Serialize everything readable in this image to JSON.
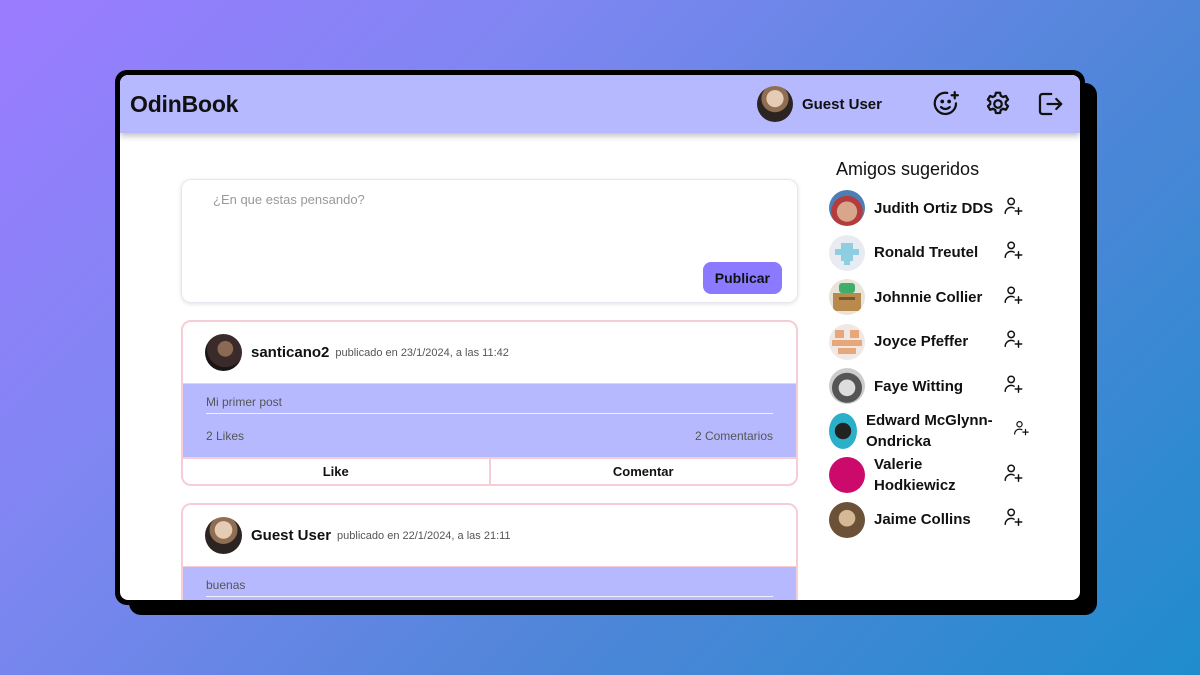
{
  "app": {
    "brand": "OdinBook"
  },
  "header": {
    "user_name": "Guest User",
    "icons": [
      "add-emoji-icon",
      "settings-gear-icon",
      "logout-icon"
    ]
  },
  "composer": {
    "placeholder": "¿En que estas pensando?",
    "publish_label": "Publicar"
  },
  "posts": [
    {
      "author": "santicano2",
      "date": "publicado en 23/1/2024, a las 11:42",
      "text": "Mi primer post",
      "likes": "2 Likes",
      "comments": "2 Comentarios",
      "like_label": "Like",
      "comment_label": "Comentar"
    },
    {
      "author": "Guest User",
      "date": "publicado en 22/1/2024, a las 21:11",
      "text": "buenas"
    }
  ],
  "sidebar": {
    "title": "Amigos sugeridos",
    "friends": [
      {
        "name": "Judith Ortiz DDS"
      },
      {
        "name": "Ronald Treutel"
      },
      {
        "name": "Johnnie Collier"
      },
      {
        "name": "Joyce Pfeffer"
      },
      {
        "name": "Faye Witting"
      },
      {
        "name": "Edward McGlynn-Ondricka"
      },
      {
        "name": "Valerie Hodkiewicz"
      },
      {
        "name": "Jaime Collins"
      }
    ]
  },
  "colors": {
    "topbar": "#b7b9ff",
    "accent": "#8b79ff",
    "post_border": "#f6cdd5"
  }
}
